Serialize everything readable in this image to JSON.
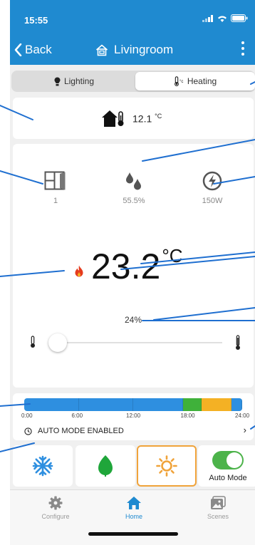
{
  "status_bar": {
    "time": "15:55"
  },
  "nav": {
    "back_label": "Back",
    "title": "Livingroom"
  },
  "segment": {
    "tabs": [
      {
        "label": "Lighting"
      },
      {
        "label": "Heating"
      }
    ],
    "active": "Heating"
  },
  "outdoor": {
    "temperature": "12.1",
    "unit": "°C"
  },
  "stats": {
    "windows_open": "1",
    "humidity": "55.5%",
    "power": "150W"
  },
  "setpoint": {
    "value": "23.2",
    "unit": "°C"
  },
  "valve": {
    "opening": "24%"
  },
  "slider": {
    "level": 0.0
  },
  "schedule": {
    "ticks": [
      "0:00",
      "6:00",
      "12:00",
      "18:00",
      "24:00"
    ],
    "segments": [
      {
        "from": 0,
        "to": 6,
        "color": "#2e8fe0"
      },
      {
        "from": 6,
        "to": 12,
        "color": "#2e8fe0"
      },
      {
        "from": 12,
        "to": 17.5,
        "color": "#2e8fe0"
      },
      {
        "from": 17.5,
        "to": 19.5,
        "color": "#3fb13a"
      },
      {
        "from": 19.5,
        "to": 22.8,
        "color": "#f4b124"
      },
      {
        "from": 22.8,
        "to": 24,
        "color": "#2e8fe0"
      }
    ],
    "auto_mode_label": "AUTO MODE ENABLED"
  },
  "modes": {
    "auto_label": "Auto Mode",
    "auto_enabled": true,
    "selected": "heat"
  },
  "tabbar": {
    "items": [
      {
        "label": "Configure"
      },
      {
        "label": "Home"
      },
      {
        "label": "Scenes"
      }
    ],
    "active": "Home"
  },
  "colors": {
    "primary": "#1f8ad0",
    "green": "#4cb34a",
    "orange": "#f0a33a",
    "cool_blue": "#2e8fe0",
    "flame_red": "#e53b1e"
  },
  "icons": [
    "back-chevron-icon",
    "home-screen-icon",
    "more-vertical-icon",
    "bulb-icon",
    "thermometer-icon",
    "house-thermometer-icon",
    "window-icon",
    "water-drops-icon",
    "power-meter-icon",
    "flame-icon",
    "clock-icon",
    "snowflake-icon",
    "leaf-icon",
    "sun-icon",
    "gear-icon",
    "home-icon",
    "scenes-icon"
  ]
}
